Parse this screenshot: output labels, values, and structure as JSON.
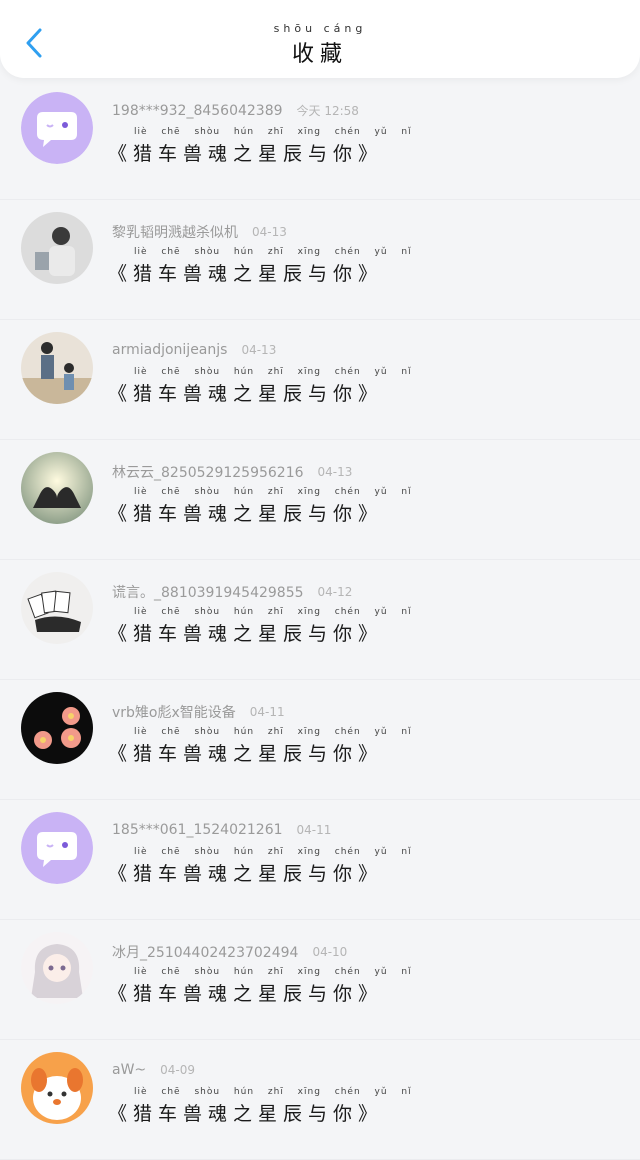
{
  "header": {
    "title_pinyin": "shōu cáng",
    "title": "收藏"
  },
  "message": {
    "pinyin": "liè chē shòu hún zhī xīng chén yǔ nǐ",
    "text": "《猎车兽魂之星辰与你》"
  },
  "items": [
    {
      "name": "198***932_8456042389",
      "time": "今天 12:58",
      "avatar": "app-logo-avatar"
    },
    {
      "name": "黎乳韬明溅越杀似机",
      "time": "04-13",
      "avatar": "man-photo-avatar"
    },
    {
      "name": "armiadjonijeanjs",
      "time": "04-13",
      "avatar": "family-photo-avatar"
    },
    {
      "name": "林云云_8250529125956216",
      "time": "04-13",
      "avatar": "hands-heart-avatar"
    },
    {
      "name": "谎言。_8810391945429855",
      "time": "04-12",
      "avatar": "cards-avatar"
    },
    {
      "name": "vrb雉o彪x智能设备",
      "time": "04-11",
      "avatar": "flowers-avatar"
    },
    {
      "name": "185***061_1524021261",
      "time": "04-11",
      "avatar": "app-logo-avatar"
    },
    {
      "name": "冰月_25104402423702494",
      "time": "04-10",
      "avatar": "anime-girl-avatar"
    },
    {
      "name": "aW~",
      "time": "04-09",
      "avatar": "cartoon-dog-avatar"
    }
  ],
  "colors": {
    "accent": "#2f9ff0",
    "logo_bg": "#c9b3f5"
  }
}
